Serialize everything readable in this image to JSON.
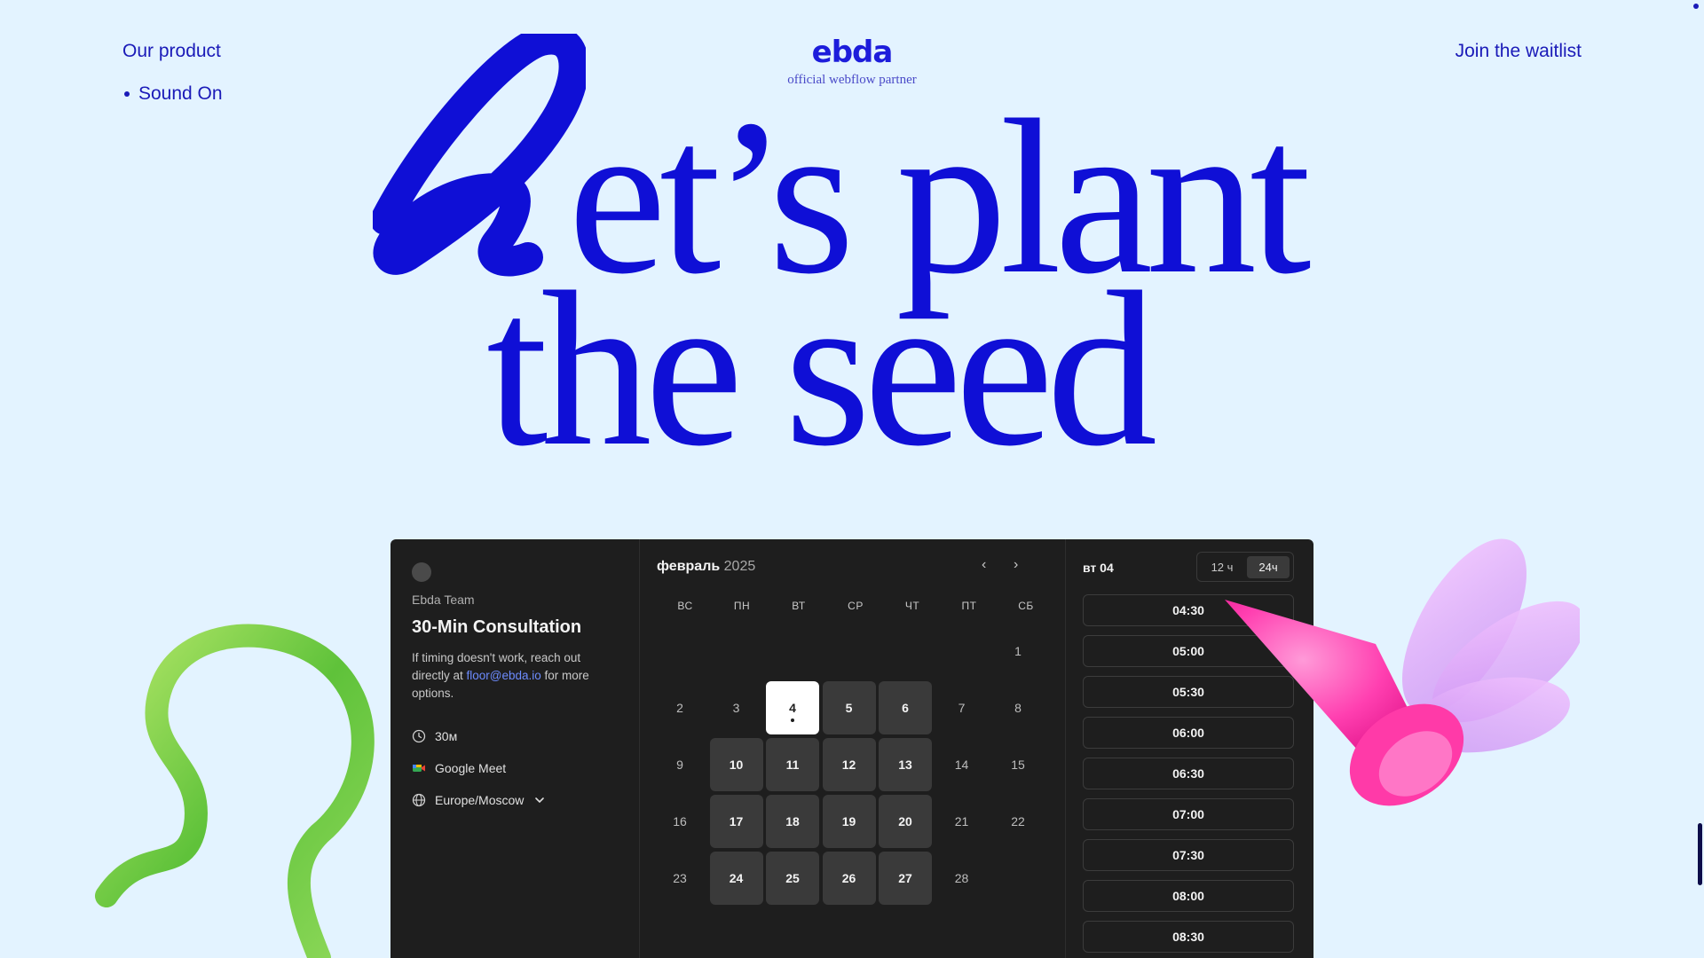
{
  "nav": {
    "product_label": "Our product",
    "sound_label": "Sound On",
    "waitlist_label": "Join the waitlist"
  },
  "logo": {
    "mark": "ebda",
    "tagline": "official webflow partner"
  },
  "hero": {
    "line1": "et’s plant",
    "line2": "the seed"
  },
  "booking": {
    "team": "Ebda Team",
    "title": "30-Min Consultation",
    "desc_before": "If timing doesn't work, reach out directly at ",
    "email": "floor@ebda.io",
    "desc_after": " for more options.",
    "duration": "30м",
    "location": "Google Meet",
    "timezone": "Europe/Moscow",
    "calendar": {
      "month": "февраль",
      "year": "2025",
      "weekdays": [
        "ВС",
        "ПН",
        "ВТ",
        "СР",
        "ЧТ",
        "ПТ",
        "СБ"
      ],
      "leading_blanks": 6,
      "days": [
        {
          "n": "1",
          "state": "off"
        },
        {
          "n": "2",
          "state": "off"
        },
        {
          "n": "3",
          "state": "off"
        },
        {
          "n": "4",
          "state": "selected"
        },
        {
          "n": "5",
          "state": "avail"
        },
        {
          "n": "6",
          "state": "avail"
        },
        {
          "n": "7",
          "state": "off"
        },
        {
          "n": "8",
          "state": "off"
        },
        {
          "n": "9",
          "state": "off"
        },
        {
          "n": "10",
          "state": "avail"
        },
        {
          "n": "11",
          "state": "avail"
        },
        {
          "n": "12",
          "state": "avail"
        },
        {
          "n": "13",
          "state": "avail"
        },
        {
          "n": "14",
          "state": "off"
        },
        {
          "n": "15",
          "state": "off"
        },
        {
          "n": "16",
          "state": "off"
        },
        {
          "n": "17",
          "state": "avail"
        },
        {
          "n": "18",
          "state": "avail"
        },
        {
          "n": "19",
          "state": "avail"
        },
        {
          "n": "20",
          "state": "avail"
        },
        {
          "n": "21",
          "state": "off"
        },
        {
          "n": "22",
          "state": "off"
        },
        {
          "n": "23",
          "state": "off"
        },
        {
          "n": "24",
          "state": "avail"
        },
        {
          "n": "25",
          "state": "avail"
        },
        {
          "n": "26",
          "state": "avail"
        },
        {
          "n": "27",
          "state": "avail"
        },
        {
          "n": "28",
          "state": "off"
        }
      ]
    },
    "selected_date": "вт 04",
    "format_12": "12 ч",
    "format_24": "24ч",
    "slots": [
      "04:30",
      "05:00",
      "05:30",
      "06:00",
      "06:30",
      "07:00",
      "07:30",
      "08:00",
      "08:30"
    ]
  },
  "colors": {
    "background": "#e3f3ff",
    "brand_blue": "#0f0fd6",
    "widget_bg": "#1e1e1e"
  }
}
